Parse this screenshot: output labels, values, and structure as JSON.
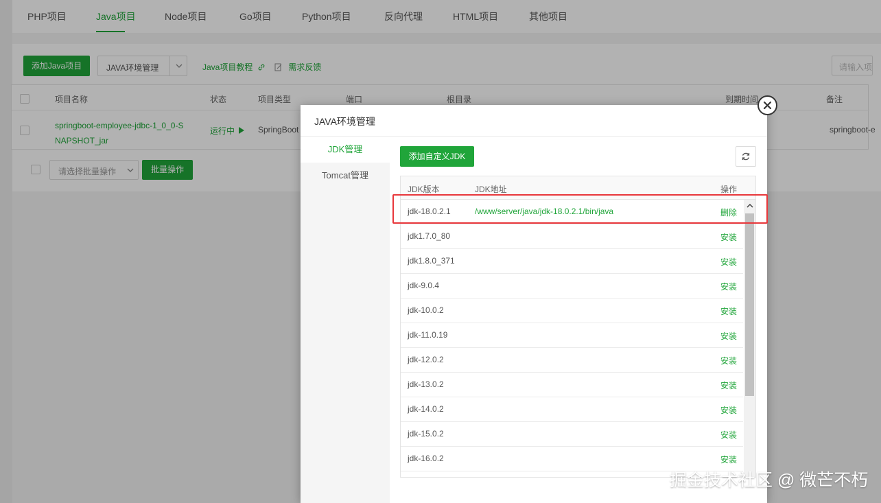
{
  "tabs": [
    "PHP项目",
    "Java项目",
    "Node项目",
    "Go项目",
    "Python项目",
    "反向代理",
    "HTML项目",
    "其他项目"
  ],
  "toolbar": {
    "add_java_project": "添加Java项目",
    "java_env_manage": "JAVA环境管理",
    "tutorial": "Java项目教程",
    "feedback": "需求反馈",
    "search_placeholder": "请输入项"
  },
  "project_table": {
    "headers": [
      "项目名称",
      "状态",
      "项目类型",
      "端口",
      "根目录",
      "到期时间",
      "备注"
    ],
    "row": {
      "name_line1": "springboot-employee-jdbc-1_0_0-S",
      "name_line2": "NAPSHOT_jar",
      "status": "运行中",
      "type": "SpringBoot",
      "remark": "springboot-e"
    },
    "batch_select": "请选择批量操作",
    "batch_button": "批量操作"
  },
  "modal": {
    "title": "JAVA环境管理",
    "side": [
      "JDK管理",
      "Tomcat管理"
    ],
    "add_jdk": "添加自定义JDK",
    "headers": {
      "version": "JDK版本",
      "path": "JDK地址",
      "op": "操作"
    },
    "rows": [
      {
        "version": "jdk-18.0.2.1",
        "path": "/www/server/java/jdk-18.0.2.1/bin/java",
        "op": "删除"
      },
      {
        "version": "jdk1.7.0_80",
        "path": "",
        "op": "安装"
      },
      {
        "version": "jdk1.8.0_371",
        "path": "",
        "op": "安装"
      },
      {
        "version": "jdk-9.0.4",
        "path": "",
        "op": "安装"
      },
      {
        "version": "jdk-10.0.2",
        "path": "",
        "op": "安装"
      },
      {
        "version": "jdk-11.0.19",
        "path": "",
        "op": "安装"
      },
      {
        "version": "jdk-12.0.2",
        "path": "",
        "op": "安装"
      },
      {
        "version": "jdk-13.0.2",
        "path": "",
        "op": "安装"
      },
      {
        "version": "jdk-14.0.2",
        "path": "",
        "op": "安装"
      },
      {
        "version": "jdk-15.0.2",
        "path": "",
        "op": "安装"
      },
      {
        "version": "jdk-16.0.2",
        "path": "",
        "op": "安装"
      }
    ]
  },
  "watermark": "掘金技术社区 @ 微芒不朽",
  "colors": {
    "accent": "#20a53a",
    "highlight": "#e8373b"
  }
}
